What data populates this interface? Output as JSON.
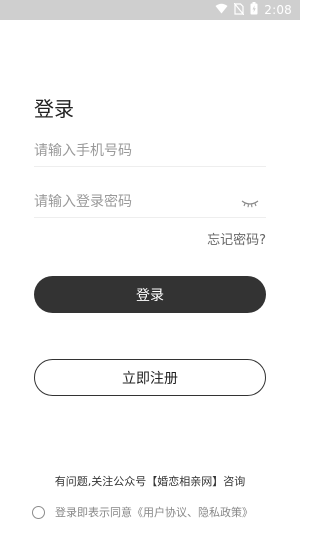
{
  "status_bar": {
    "time": "2:08",
    "icons": [
      "wifi-icon",
      "no-sim-icon",
      "battery-charging-icon"
    ]
  },
  "login": {
    "title": "登录",
    "phone_placeholder": "请输入手机号码",
    "password_placeholder": "请输入登录密码",
    "forgot_password": "忘记密码?",
    "login_button": "登录",
    "register_button": "立即注册"
  },
  "footer": {
    "notice": "有问题,关注公众号【婚恋相亲网】咨询",
    "agree_prefix": "登录即表示同意",
    "agree_link": "《用户协议、隐私政策》"
  }
}
